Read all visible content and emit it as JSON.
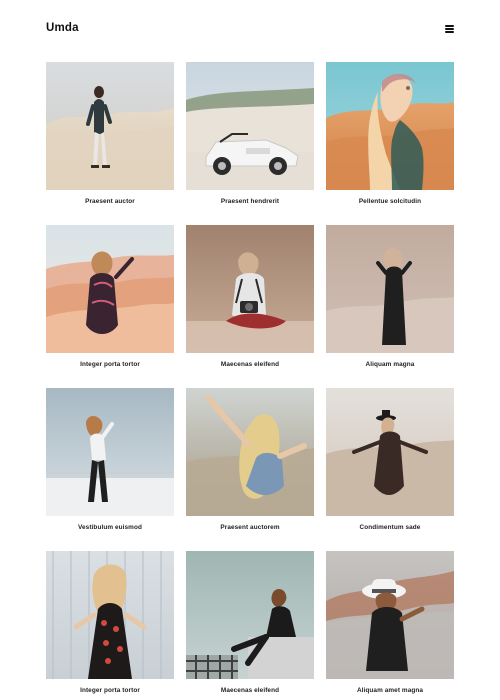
{
  "app": {
    "brand": "Umda",
    "menu_icon": "hamburger-menu-icon"
  },
  "gallery": {
    "items": [
      {
        "caption": "Praesent auctor",
        "image": "woman-standing-on-sand-dunes"
      },
      {
        "caption": "Praesent hendrerit",
        "image": "white-convertible-car-on-beach"
      },
      {
        "caption": "Pellentue solcitudin",
        "image": "woman-with-headscarf-desert"
      },
      {
        "caption": "Integer porta tortor",
        "image": "woman-in-floral-dress-desert"
      },
      {
        "caption": "Maecenas eleifend",
        "image": "woman-sitting-on-sand-camera"
      },
      {
        "caption": "Aliquam magna",
        "image": "woman-in-black-dress-dunes"
      },
      {
        "caption": "Vestibulum euismod",
        "image": "woman-in-black-pants-white-sand"
      },
      {
        "caption": "Praesent auctorem",
        "image": "blonde-woman-raising-arm"
      },
      {
        "caption": "Condimentum sade",
        "image": "woman-with-hat-walking-desert"
      },
      {
        "caption": "Integer porta tortor",
        "image": "woman-in-floral-slip-dress"
      },
      {
        "caption": "Maecenas eleifend",
        "image": "woman-sitting-on-concrete-wall"
      },
      {
        "caption": "Aliquam amet magna",
        "image": "woman-wearing-white-hat"
      }
    ]
  },
  "colors": {
    "background": "#ffffff",
    "text": "#111111",
    "caption": "#222222"
  }
}
